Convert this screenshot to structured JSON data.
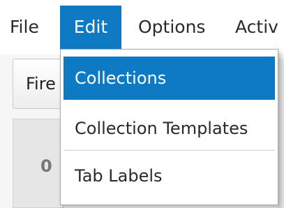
{
  "menubar": {
    "items": [
      {
        "label": "File"
      },
      {
        "label": "Edit"
      },
      {
        "label": "Options"
      },
      {
        "label": "Activ"
      }
    ]
  },
  "content": {
    "fire_button_label": "Fire",
    "count_label": "0"
  },
  "dropdown": {
    "items": [
      {
        "label": "Collections",
        "selected": true
      },
      {
        "label": "Collection Templates",
        "selected": false
      },
      {
        "label": "Tab Labels",
        "selected": false
      }
    ]
  },
  "colors": {
    "accent": "#0f7ac4"
  }
}
